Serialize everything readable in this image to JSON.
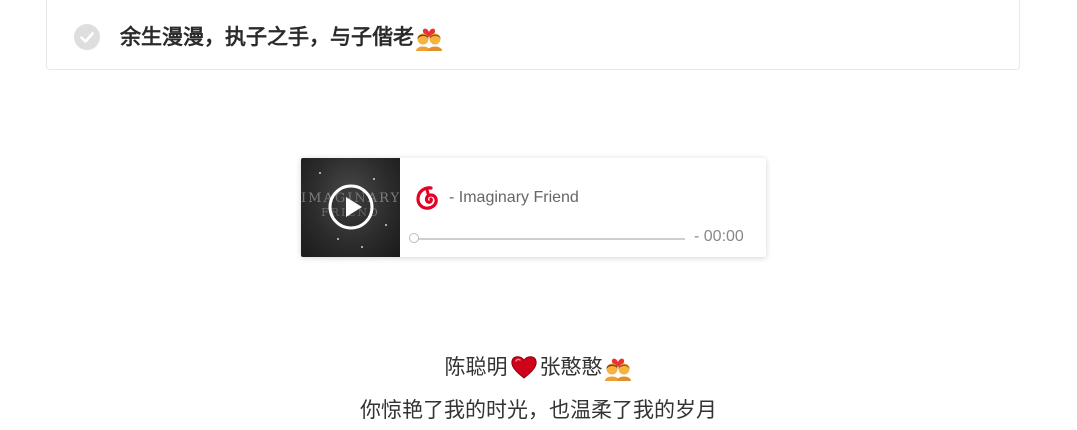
{
  "motto_card": {
    "text": "余生漫漫，执子之手，与子偕老",
    "check_icon": "check-circle-icon",
    "emoji": "couple-with-heart-icon"
  },
  "player": {
    "title": "- Imaginary Friend",
    "time": "- 00:00",
    "cover": {
      "line1": "IMAGINARY",
      "line2": "FRIEND"
    },
    "progress": 0,
    "icons": {
      "play": "play-icon",
      "brand": "netease-cloud-music-icon"
    }
  },
  "footer": {
    "name_left": "陈聪明",
    "name_right": "张憨憨",
    "line2": "你惊艳了我的时光，也温柔了我的岁月"
  },
  "colors": {
    "brand_red": "#e60026",
    "heart": "#d0021b",
    "text": "#333333",
    "check_gray": "#dcdcdc"
  }
}
